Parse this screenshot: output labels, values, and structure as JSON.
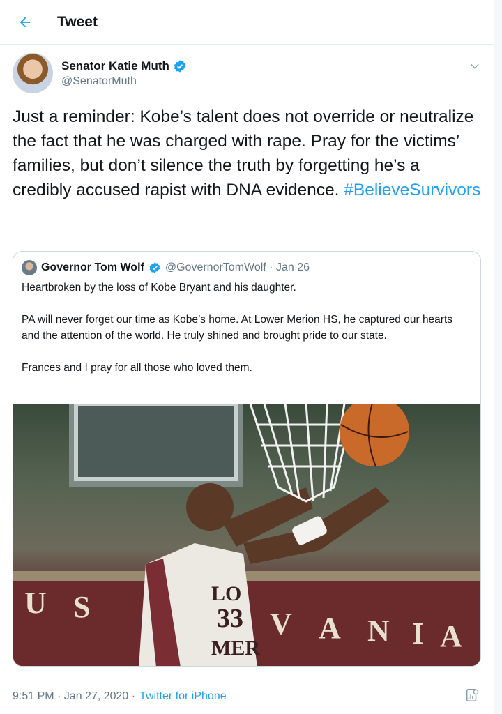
{
  "header": {
    "title": "Tweet",
    "back_icon": "arrow-left-icon"
  },
  "author": {
    "name": "Senator Katie Muth",
    "handle": "@SenatorMuth",
    "verified_icon": "verified-badge-icon",
    "menu_icon": "chevron-down-icon"
  },
  "tweet": {
    "text": "Just a reminder: Kobe’s talent does not override or neutralize the fact that he was charged with rape.  Pray for the victims’ families, but don’t silence the truth by forgetting he’s a credibly accused rapist with DNA evidence.  ",
    "hashtag": "#BelieveSurvivors"
  },
  "quote": {
    "name": "Governor Tom Wolf",
    "meta": "@GovernorTomWolf · Jan 26",
    "paragraphs": [
      "Heartbroken by the loss of Kobe Bryant and his daughter.",
      "PA will never forget our time as Kobe’s home. At Lower Merion HS, he captured our hearts and the attention of the world. He truly shined and brought pride to our state.",
      "Frances and I pray for all those who loved them."
    ],
    "image": {
      "jersey_top": "LO",
      "jersey_number": "33",
      "jersey_bottom": "MER",
      "banner": [
        "U",
        "S",
        "V",
        "A",
        "N",
        "I",
        "A"
      ]
    }
  },
  "footer": {
    "time": "9:51 PM · Jan 27, 2020 · ",
    "source": "Twitter for iPhone",
    "analytics_icon": "analytics-icon"
  },
  "colors": {
    "accent": "#1da1f2",
    "text": "#14171a",
    "muted": "#657786",
    "border": "#e6ecf0"
  }
}
